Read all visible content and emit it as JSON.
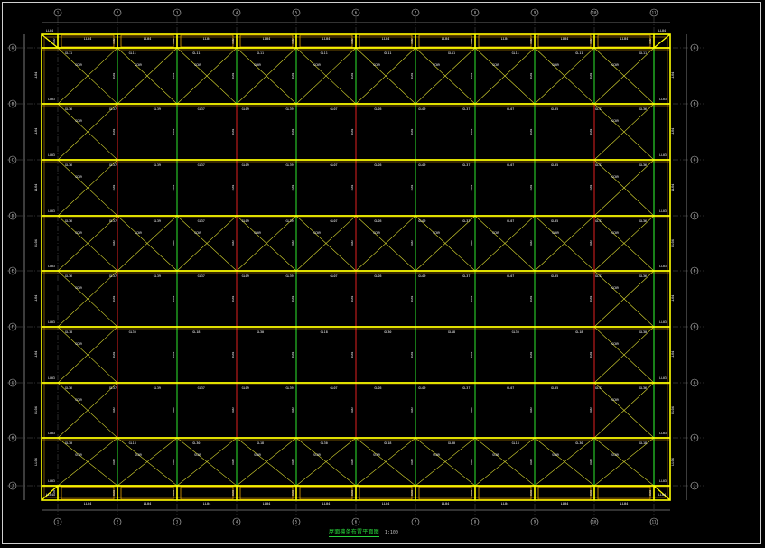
{
  "drawing": {
    "title": "屋面檩条布置平面图",
    "scale": "1:100",
    "col_axes": [
      "1",
      "2",
      "3",
      "4",
      "5",
      "6",
      "7",
      "8",
      "9",
      "10",
      "11"
    ],
    "row_axes": [
      "A",
      "B",
      "C",
      "D",
      "E",
      "F",
      "G",
      "H",
      "J"
    ],
    "eave_labels": [
      "LL04",
      "LL04",
      "LL04",
      "LL04",
      "LL04",
      "LL04",
      "LL04",
      "LL04",
      "LL04",
      "LL04"
    ],
    "corner_labels": [
      "LL04",
      "LL04",
      "LL04",
      "LL04"
    ],
    "left_side_labels": [
      "LL04",
      "LL04",
      "LL04",
      "LL04",
      "LL04",
      "LL04",
      "LL04",
      "LL04"
    ],
    "right_side_labels": [
      "LL04",
      "LL04",
      "LL04",
      "LL04",
      "LL04",
      "LL04",
      "LL04",
      "LL04"
    ],
    "left_tie_labels": [
      "LL03",
      "LL03",
      "LL03",
      "LL03",
      "LL03",
      "LL03",
      "LL03",
      "LL03"
    ],
    "right_tie_labels": [
      "LL03",
      "LL03",
      "LL03",
      "LL03",
      "LL03",
      "LL03",
      "LL03",
      "LL03"
    ],
    "row_purlins": [
      [
        "GL11",
        "GL11",
        "GL11",
        "GL11",
        "GL11",
        "GL11",
        "GL11",
        "GL11",
        "GL11",
        "GL11"
      ],
      [
        "GL36",
        "GL37",
        "GL39",
        "GL37",
        "GL09",
        "GL39",
        "GL07",
        "GL05",
        "GL09",
        "GL37",
        "GL07",
        "GL05",
        "GL37",
        "GL36"
      ],
      [
        "GL36",
        "GL37",
        "GL39",
        "GL37",
        "GL09",
        "GL39",
        "GL07",
        "GL05",
        "GL09",
        "GL37",
        "GL07",
        "GL05",
        "GL37",
        "GL36"
      ],
      [
        "GL36",
        "GL37",
        "GL39",
        "GL37",
        "GL09",
        "GL39",
        "GL07",
        "GL05",
        "GL09",
        "GL37",
        "GL07",
        "GL05",
        "GL37",
        "GL36"
      ],
      [
        "GL36",
        "GL37",
        "GL39",
        "GL37",
        "GL09",
        "GL39",
        "GL07",
        "GL05",
        "GL09",
        "GL37",
        "GL07",
        "GL05",
        "GL37",
        "GL36"
      ],
      [
        "GL18",
        "GL30",
        "GL18",
        "GL30",
        "GL18",
        "GL30",
        "GL18",
        "GL30",
        "GL18",
        "GL30"
      ],
      [
        "GL36",
        "GL37",
        "GL39",
        "GL37",
        "GL09",
        "GL39",
        "GL07",
        "GL05",
        "GL09",
        "GL37",
        "GL07",
        "GL05",
        "GL37",
        "GL36"
      ],
      [
        "GL30",
        "GL18",
        "GL30",
        "GL18",
        "GL30",
        "GL18",
        "GL30",
        "GL18",
        "GL30",
        "GL18"
      ]
    ],
    "brace_label": "SC09",
    "tie_label": "XG02",
    "legend_colors": {
      "axis": "#c8c8c8",
      "purlin": "#ffff00",
      "purlin_edge": "#e0a000",
      "brace": "#d8d830",
      "tie_green": "#2ee82e",
      "tie_red": "#e02020",
      "text": "#ffffff"
    }
  }
}
